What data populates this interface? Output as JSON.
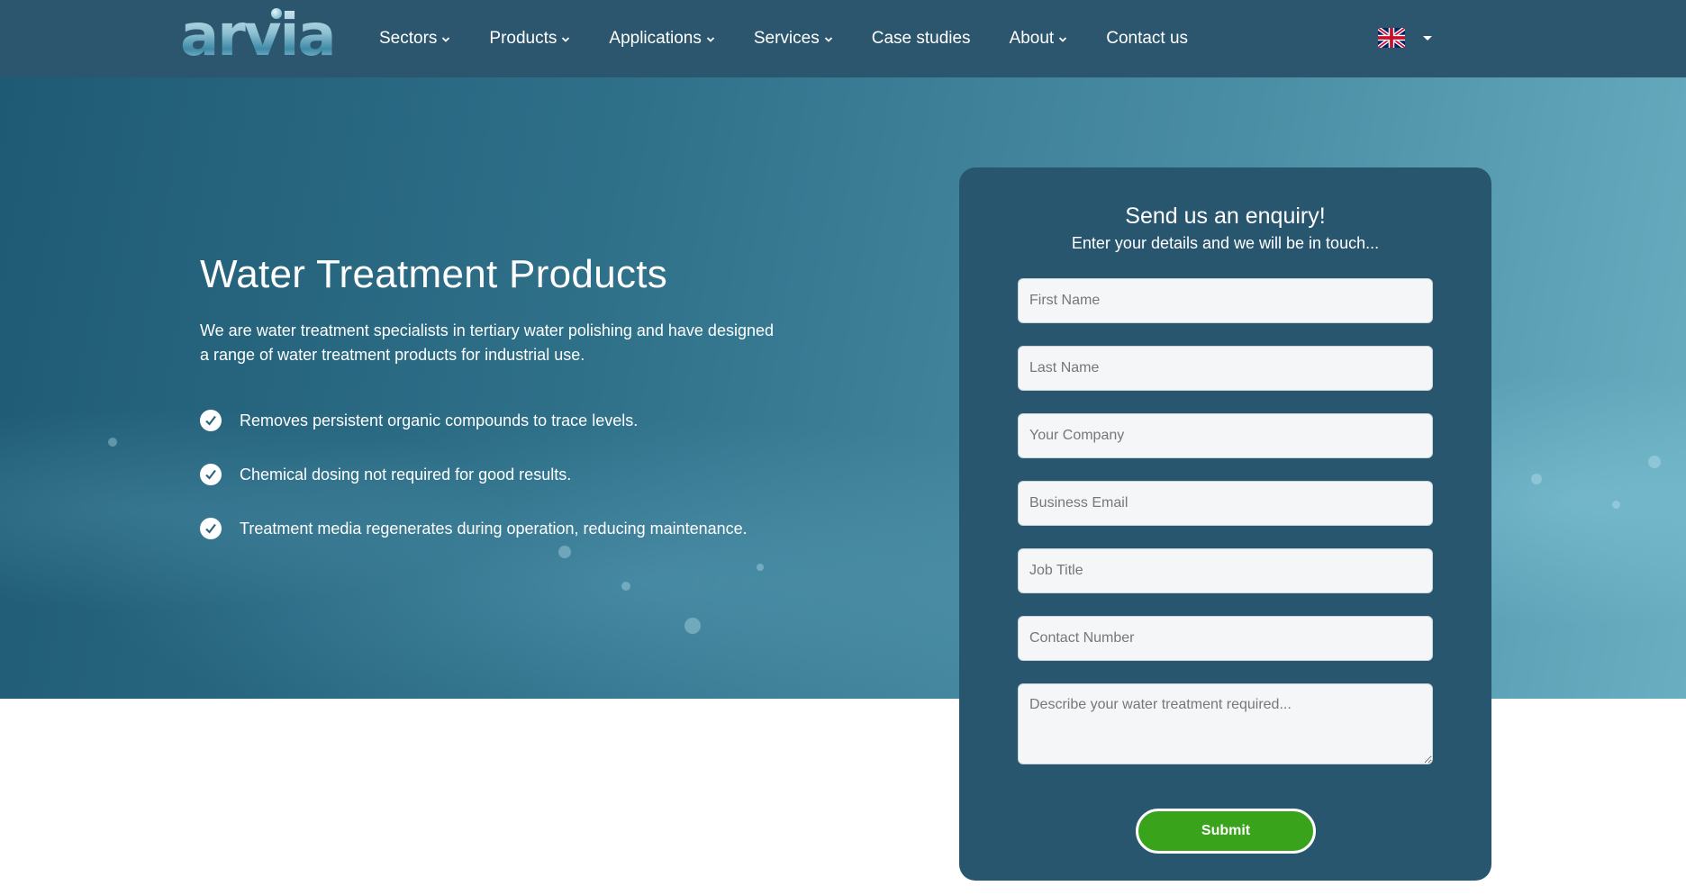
{
  "brand": {
    "logo_text": "arvia"
  },
  "nav": {
    "items": [
      {
        "label": "Sectors",
        "has_dropdown": true
      },
      {
        "label": "Products",
        "has_dropdown": true
      },
      {
        "label": "Applications",
        "has_dropdown": true
      },
      {
        "label": "Services",
        "has_dropdown": true
      },
      {
        "label": "Case studies",
        "has_dropdown": false
      },
      {
        "label": "About",
        "has_dropdown": true
      },
      {
        "label": "Contact us",
        "has_dropdown": false
      }
    ],
    "language_icon": "uk-flag-icon"
  },
  "hero": {
    "title": "Water Treatment Products",
    "description": "We are water treatment specialists in tertiary water polishing and have designed a range of water treatment products for industrial use.",
    "benefits": [
      "Removes persistent organic compounds to trace levels.",
      "Chemical dosing not required for good results.",
      "Treatment media regenerates during operation, reducing maintenance."
    ]
  },
  "form": {
    "title": "Send us an enquiry!",
    "subtitle": "Enter your details and we will be in touch...",
    "fields": {
      "first_name": "First Name",
      "last_name": "Last Name",
      "company": "Your Company",
      "email": "Business Email",
      "job_title": "Job Title",
      "phone": "Contact Number",
      "message": "Describe your water treatment required..."
    },
    "submit_label": "Submit"
  },
  "colors": {
    "nav_bg": "#2b566e",
    "form_bg": "#29566f",
    "submit_green": "#3aa31c"
  }
}
